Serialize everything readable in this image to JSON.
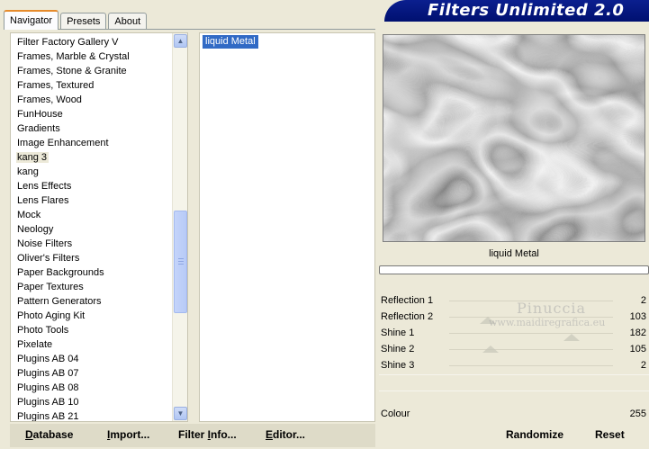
{
  "tabs": [
    {
      "label": "Navigator",
      "active": true
    },
    {
      "label": "Presets",
      "active": false
    },
    {
      "label": "About",
      "active": false
    }
  ],
  "banner": {
    "title": "Filters Unlimited 2.0"
  },
  "categories": [
    "Filter Factory Gallery V",
    "Frames, Marble & Crystal",
    "Frames, Stone & Granite",
    "Frames, Textured",
    "Frames, Wood",
    "FunHouse",
    "Gradients",
    "Image Enhancement",
    "kang 3",
    "kang",
    "Lens Effects",
    "Lens Flares",
    "Mock",
    "Neology",
    "Noise Filters",
    "Oliver's Filters",
    "Paper Backgrounds",
    "Paper Textures",
    "Pattern Generators",
    "Photo Aging Kit",
    "Photo Tools",
    "Pixelate",
    "Plugins AB 04",
    "Plugins AB 07",
    "Plugins AB 08",
    "Plugins AB 10",
    "Plugins AB 21"
  ],
  "selected_category": "kang 3",
  "filters": [
    "liquid Metal"
  ],
  "preview": {
    "filter_name": "liquid Metal"
  },
  "params": [
    {
      "label": "Reflection 1",
      "value": "2"
    },
    {
      "label": "Reflection 2",
      "value": "103"
    },
    {
      "label": "Shine 1",
      "value": "182"
    },
    {
      "label": "Shine 2",
      "value": "105"
    },
    {
      "label": "Shine 3",
      "value": "2"
    }
  ],
  "color_param": {
    "label": "Colour",
    "value": "255"
  },
  "watermark": {
    "line1": "Pinuccia",
    "line2": "www.maidiregrafica.eu"
  },
  "buttons": {
    "database": {
      "first": "D",
      "rest": "atabase"
    },
    "import": {
      "first": "I",
      "rest": "mport..."
    },
    "filter_info": {
      "pre": "Filter ",
      "first": "I",
      "rest": "nfo..."
    },
    "editor": {
      "first": "E",
      "rest": "ditor..."
    },
    "randomize": "Randomize",
    "reset": "Reset"
  }
}
